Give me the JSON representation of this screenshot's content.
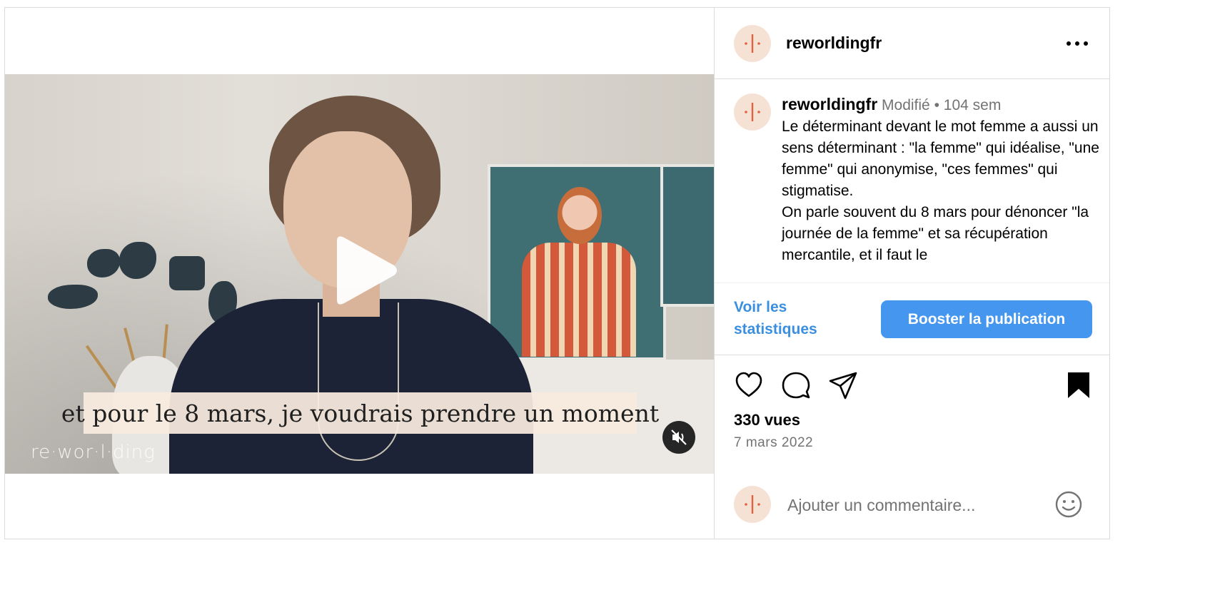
{
  "post": {
    "username": "reworldingfr",
    "icons": {
      "avatar": "reworlding-logo",
      "more": "more-horizontal-icon"
    }
  },
  "video": {
    "caption": "et pour le 8 mars, je voudrais prendre un moment",
    "watermark": "re·wor·l·ding",
    "icons": {
      "play": "play-icon",
      "mute": "muted-speaker-icon"
    }
  },
  "caption": {
    "username": "reworldingfr",
    "edited": "Modifié",
    "separator": "•",
    "age": "104 sem",
    "text": "Le déterminant devant le mot femme a aussi un sens déterminant : \"la femme\" qui idéalise, \"une femme\" qui anonymise, \"ces femmes\" qui stigmatise.\nOn parle souvent du 8 mars pour dénoncer \"la journée de la femme\" et sa récupération mercantile, et il faut le"
  },
  "actions": {
    "stats_link": "Voir les statistiques",
    "boost_button": "Booster la publication",
    "icons": [
      "heart-icon",
      "comment-icon",
      "share-icon",
      "bookmark-icon"
    ]
  },
  "meta": {
    "views": "330 vues",
    "date": "7 mars 2022"
  },
  "comment": {
    "placeholder": "Ajouter un commentaire...",
    "icons": {
      "emoji": "emoji-icon"
    }
  },
  "colors": {
    "accent": "#4596ee",
    "link": "#3b8fe0",
    "avatar_bg": "#f6e2d5",
    "avatar_mark": "#e0623f",
    "muted_text": "#737373",
    "border": "#dbdbdb"
  }
}
